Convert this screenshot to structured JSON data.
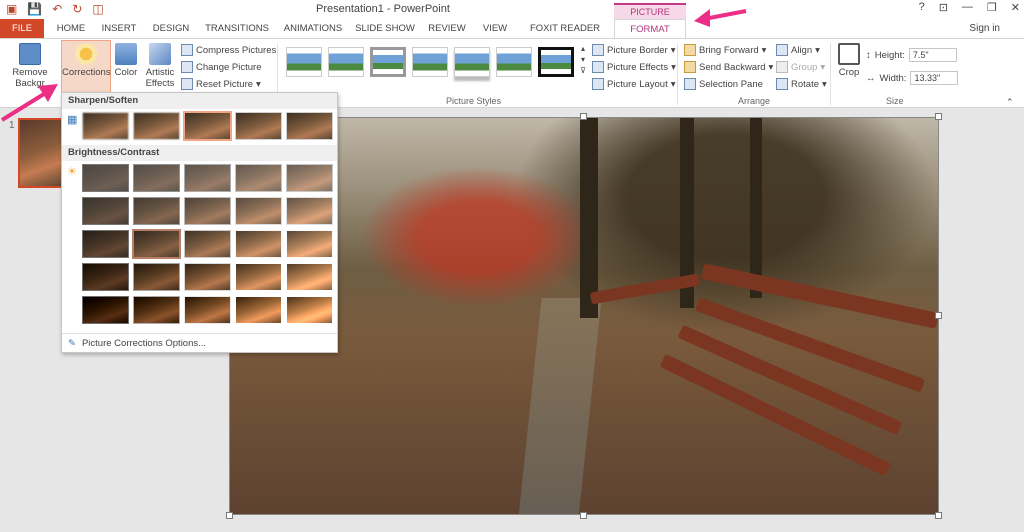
{
  "window": {
    "title": "Presentation1 - PowerPoint",
    "context_tab_group": "PICTURE TOOLS",
    "controls": [
      "?",
      "⊡",
      "—",
      "❐",
      "✕"
    ]
  },
  "tabs": [
    "FILE",
    "HOME",
    "INSERT",
    "DESIGN",
    "TRANSITIONS",
    "ANIMATIONS",
    "SLIDE SHOW",
    "REVIEW",
    "VIEW",
    "FOXIT READER PDF",
    "FORMAT"
  ],
  "signin": "Sign in",
  "ribbon": {
    "adjust": {
      "remove_background": "Remove Backgr",
      "corrections": "Corrections",
      "color": "Color",
      "artistic_effects_1": "Artistic",
      "artistic_effects_2": "Effects",
      "compress": "Compress Pictures",
      "change": "Change Picture",
      "reset": "Reset Picture"
    },
    "picture_styles": {
      "label": "Picture Styles",
      "border": "Picture Border",
      "effects": "Picture Effects",
      "layout": "Picture Layout"
    },
    "arrange": {
      "label": "Arrange",
      "bring_forward": "Bring Forward",
      "send_backward": "Send Backward",
      "selection_pane": "Selection Pane",
      "align": "Align",
      "group": "Group",
      "rotate": "Rotate"
    },
    "size": {
      "label": "Size",
      "crop": "Crop",
      "height_label": "Height:",
      "height_value": "7.5\"",
      "width_label": "Width:",
      "width_value": "13.33\""
    }
  },
  "dropdown": {
    "sharpen_title": "Sharpen/Soften",
    "brightness_title": "Brightness/Contrast",
    "footer": "Picture Corrections Options...",
    "sharpen_presets": [
      "Soften: 50%",
      "Soften: 25%",
      "Sharpen: 0%",
      "Sharpen: 25%",
      "Sharpen: 50%"
    ],
    "brightness_rows": 5,
    "brightness_cols": 5
  },
  "slide_panel": {
    "number": "1"
  },
  "accent": {
    "file": "#d24726",
    "format": "#c23b8a",
    "arrow": "#ec2e86",
    "selection": "#f1a585"
  }
}
